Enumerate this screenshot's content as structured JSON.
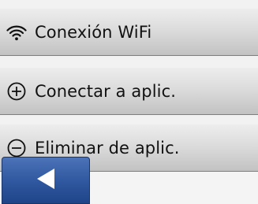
{
  "menu": {
    "items": [
      {
        "label": "Conexión WiFi",
        "icon": "wifi-icon"
      },
      {
        "label": "Conectar a aplic.",
        "icon": "plus-circle-icon"
      },
      {
        "label": "Eliminar de aplic.",
        "icon": "minus-circle-icon"
      }
    ]
  },
  "navigation": {
    "back_icon": "back-arrow-icon",
    "accent_color": "#3059a1"
  }
}
